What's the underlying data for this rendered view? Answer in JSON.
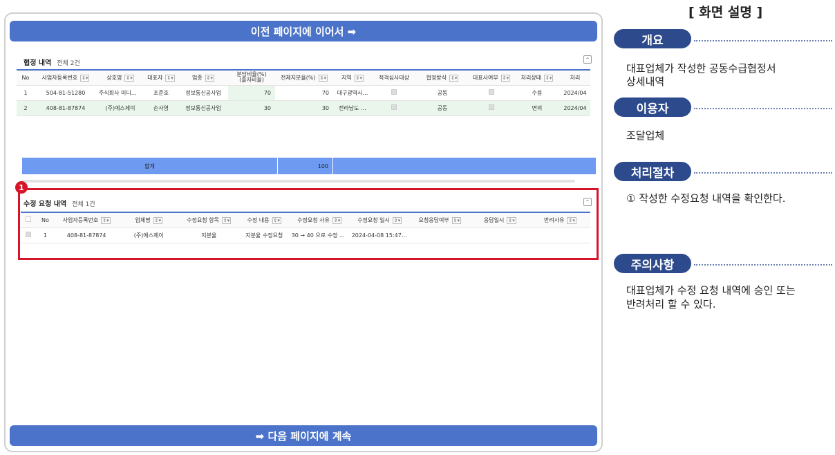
{
  "banner_top": "이전 페이지에 이어서 ➡",
  "banner_bottom": "➡ 다음 페이지에 계속",
  "agreement": {
    "title": "협정 내역",
    "count": "전체 2건",
    "collapse": "⌃",
    "headers": [
      "No",
      "사업자등록번호",
      "상호명",
      "대표자",
      "업종",
      "분담비율(%)\n(출자비율)",
      "전체지분율(%)",
      "지역",
      "적격심사대상",
      "협정방식",
      "대표사여부",
      "처리상태",
      "처리"
    ],
    "rows": [
      {
        "no": "1",
        "biz": "504-81-51280",
        "name": "주식회사 미디어…",
        "ceo": "조준호",
        "ind": "정보통신공사업",
        "ratio": "70",
        "share": "70",
        "region": "대구광역시…",
        "method": "공동",
        "status": "수용",
        "date": "2024/04"
      },
      {
        "no": "2",
        "biz": "408-81-87874",
        "name": "(주)에스제이",
        "ceo": "손사영",
        "ind": "정보통신공사업",
        "ratio": "30",
        "share": "30",
        "region": "전라남도 …",
        "method": "공동",
        "status": "면의",
        "date": "2024/04"
      }
    ],
    "sum_label": "합계",
    "sum_value": "100"
  },
  "marker": "1",
  "modify": {
    "title": "수정 요청 내역",
    "count": "전체 1건",
    "collapse": "⌃",
    "headers": [
      "No",
      "사업자등록번호",
      "업체명",
      "수정요청 항목",
      "수정 내용",
      "수정요청 사유",
      "수정요청 일시",
      "요청응답여부",
      "응답일시",
      "반려사유"
    ],
    "rows": [
      {
        "no": "1",
        "biz": "408-81-87874",
        "name": "(주)에스제이",
        "item": "지분율",
        "content": "지분율 수정요청",
        "reason": "30 → 40 으로 수정 요청",
        "date": "2024-04-08 15:47:43",
        "resp": "",
        "resp_date": "",
        "reject": ""
      }
    ]
  },
  "panel": {
    "title": "[ 화면 설명 ]",
    "overview_label": "개요",
    "overview_text": [
      "대표업체가 작성한 공동수급협정서",
      "상세내역"
    ],
    "user_label": "이용자",
    "user_text": "조달업체",
    "process_label": "처리절차",
    "process_text": "① 작성한 수정요청 내역을 확인한다.",
    "caution_label": "주의사항",
    "caution_text": [
      "대표업체가 수정 요청 내역에 승인 또는",
      "반려처리 할 수 있다."
    ]
  },
  "colors": {
    "accent": "#4a73c9",
    "pill": "#2d4a8c",
    "highlight": "#d5152a",
    "sum_bar": "#6e9bf1"
  }
}
